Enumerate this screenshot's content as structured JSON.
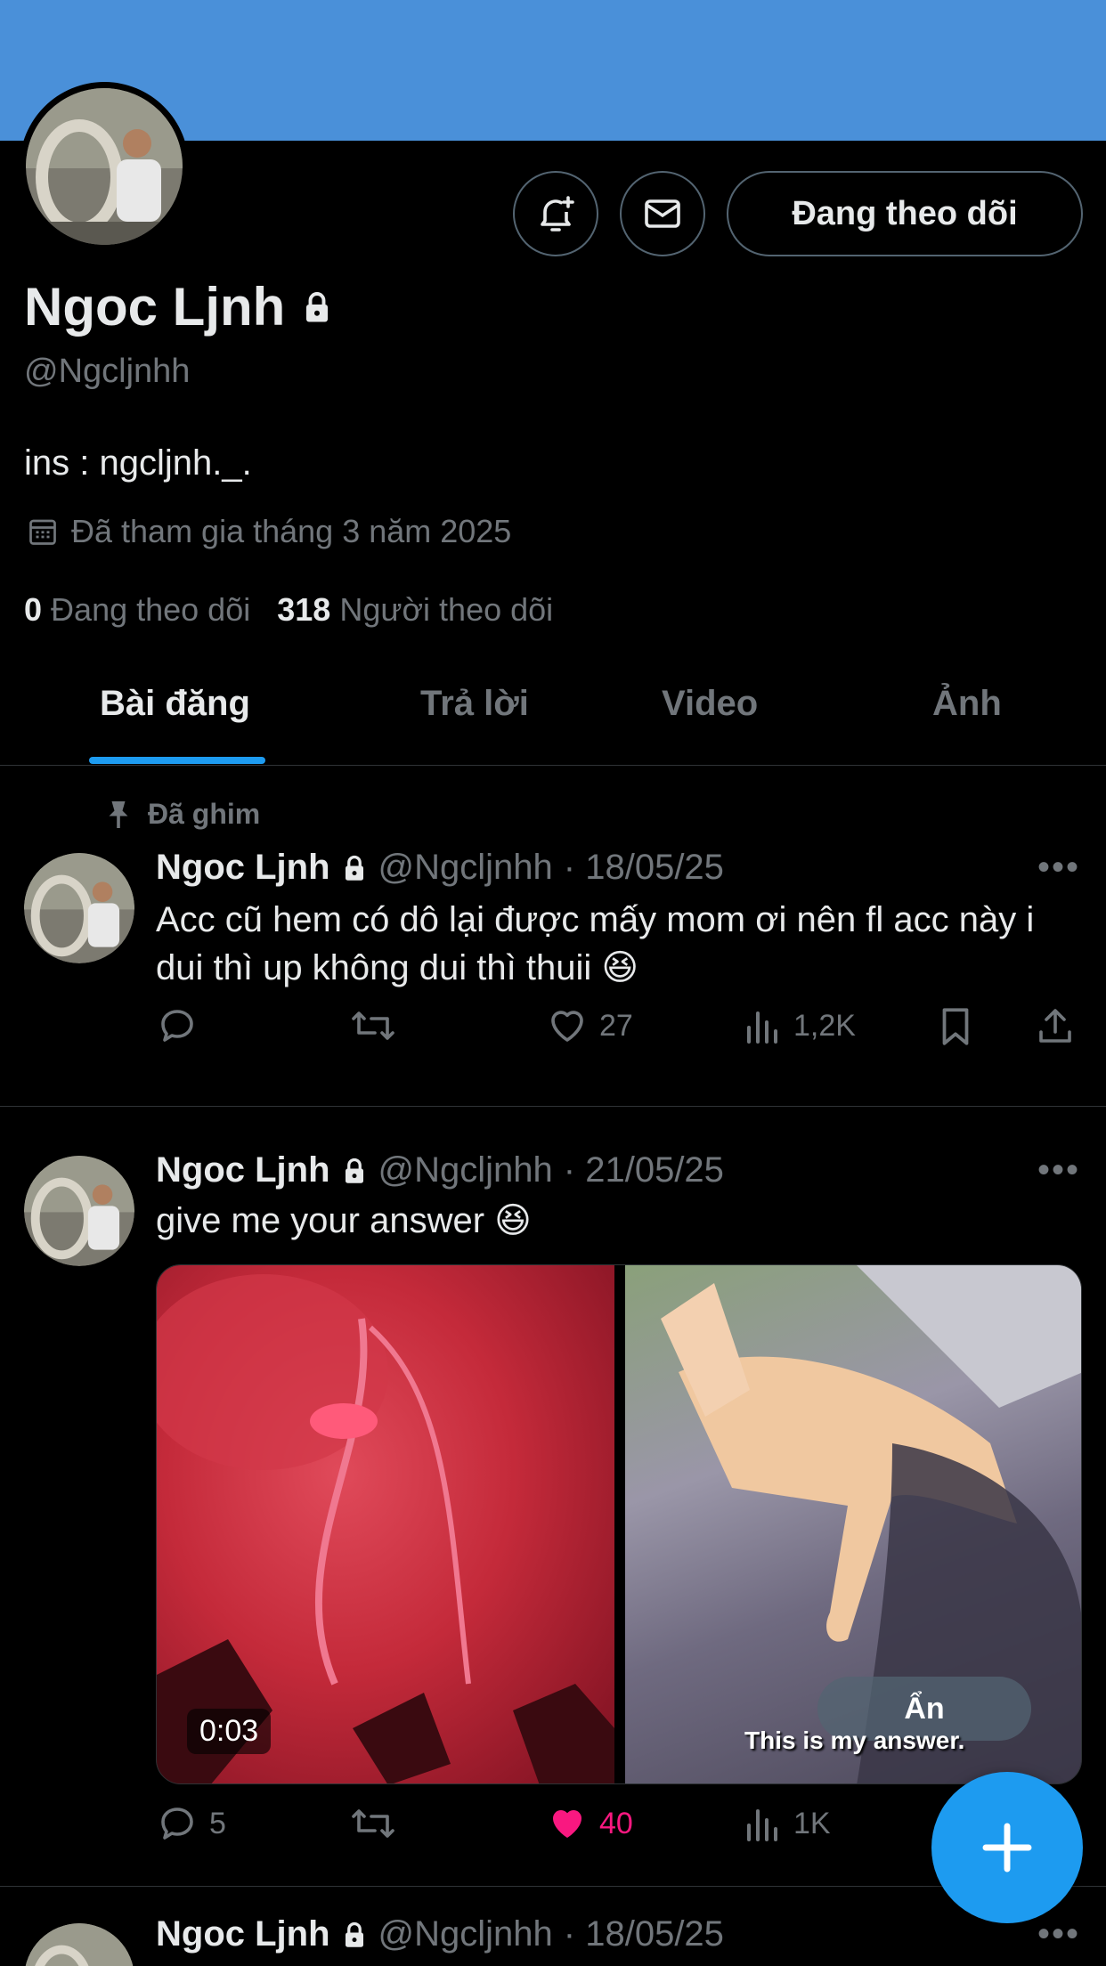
{
  "profile": {
    "name": "Ngoc Ljnh",
    "handle": "@Ngcljnhh",
    "bio": "ins : ngcljnh._.",
    "joined": "Đã tham gia tháng 3 năm 2025",
    "following_count": "0",
    "following_label": "Đang theo dõi",
    "followers_count": "318",
    "followers_label": "Người theo dõi",
    "follow_button": "Đang theo dõi",
    "banner_color": "#4a90d9"
  },
  "tabs": [
    {
      "label": "Bài đăng",
      "active": true
    },
    {
      "label": "Trả lời",
      "active": false
    },
    {
      "label": "Video",
      "active": false
    },
    {
      "label": "Ảnh",
      "active": false
    }
  ],
  "posts": [
    {
      "pinned_label": "Đã ghim",
      "name": "Ngoc Ljnh",
      "handle": "@Ngcljnhh",
      "date": "· 18/05/25",
      "text": "Acc cũ hem có dô lại được mấy mom ơi nên fl acc này i dui thì up không dui thì thuii 😆",
      "likes": "27",
      "views": "1,2K"
    },
    {
      "name": "Ngoc Ljnh",
      "handle": "@Ngcljnhh",
      "date": "· 21/05/25",
      "text": "give me your answer 😆",
      "video_duration": "0:03",
      "hide_label": "Ẩn",
      "caption": "This is my answer.",
      "replies": "5",
      "likes": "40",
      "views": "1K"
    },
    {
      "name": "Ngoc Ljnh",
      "handle": "@Ngcljnhh",
      "date": "· 18/05/25"
    }
  ],
  "colors": {
    "accent": "#1d9bf0",
    "like": "#f91880",
    "muted": "#71767b"
  }
}
